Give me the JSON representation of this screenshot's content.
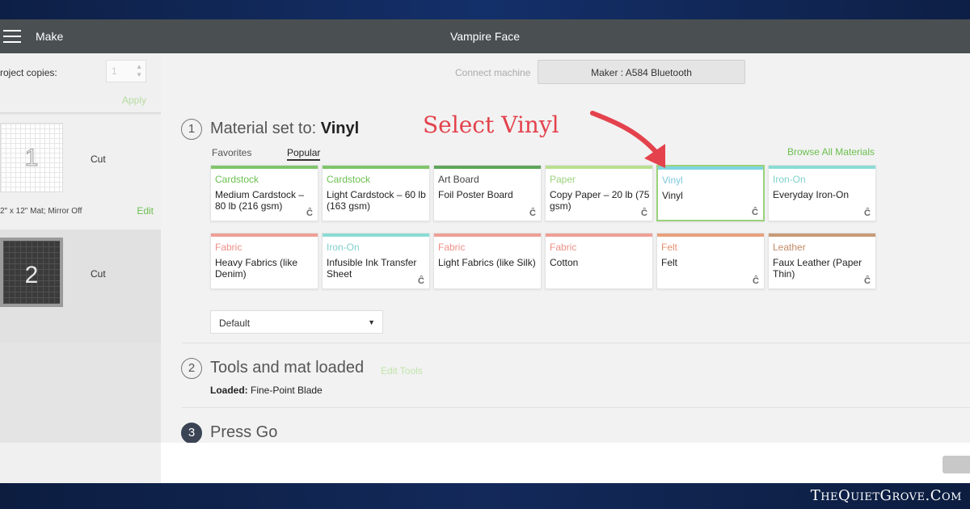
{
  "app": {
    "menu_label": "Make",
    "project_title": "Vampire Face"
  },
  "sidebar": {
    "copies_label": "roject copies:",
    "copies_value": "1",
    "apply_label": "Apply",
    "mats": [
      {
        "number": "1",
        "action": "Cut",
        "info": "2\" x 12\" Mat; Mirror Off",
        "edit_label": "Edit",
        "theme": "light"
      },
      {
        "number": "2",
        "action": "Cut",
        "theme": "dark"
      }
    ]
  },
  "connect": {
    "label": "Connect machine",
    "machine": "Maker : A584 Bluetooth"
  },
  "step1": {
    "number": "1",
    "title_prefix": "Material set to:",
    "title_value": "Vinyl",
    "tabs": [
      "Favorites",
      "Popular"
    ],
    "active_tab": "Popular",
    "browse_label": "Browse All Materials",
    "materials": [
      {
        "category": "Cardstock",
        "name": "Medium Cardstock – 80 lb (216 gsm)",
        "color": "#7fc56b",
        "cat_color": "#6bbf4e",
        "icon": true
      },
      {
        "category": "Cardstock",
        "name": "Light Cardstock – 60 lb (163 gsm)",
        "color": "#7fc56b",
        "cat_color": "#6bbf4e",
        "icon": false
      },
      {
        "category": "Art Board",
        "name": "Foil Poster Board",
        "color": "#5ea65a",
        "cat_color": "#444444",
        "icon": true
      },
      {
        "category": "Paper",
        "name": "Copy Paper – 20 lb (75 gsm)",
        "color": "#b9e08f",
        "cat_color": "#9bd27d",
        "icon": true
      },
      {
        "category": "Vinyl",
        "name": "Vinyl",
        "color": "#7fd6e0",
        "cat_color": "#7fc8e0",
        "icon": true,
        "selected": true
      },
      {
        "category": "Iron-On",
        "name": "Everyday Iron-On",
        "color": "#8adcd4",
        "cat_color": "#7fd0cc",
        "icon": true
      },
      {
        "category": "Fabric",
        "name": "Heavy Fabrics (like Denim)",
        "color": "#ef9e96",
        "cat_color": "#ef8f86",
        "icon": false
      },
      {
        "category": "Iron-On",
        "name": "Infusible Ink Transfer Sheet",
        "color": "#8adcd4",
        "cat_color": "#7fd0cc",
        "icon": true
      },
      {
        "category": "Fabric",
        "name": "Light Fabrics (like Silk)",
        "color": "#ef9e96",
        "cat_color": "#ef8f86",
        "icon": false
      },
      {
        "category": "Fabric",
        "name": "Cotton",
        "color": "#ef9e96",
        "cat_color": "#ef8f86",
        "icon": false
      },
      {
        "category": "Felt",
        "name": "Felt",
        "color": "#e9a07e",
        "cat_color": "#e59070",
        "icon": true
      },
      {
        "category": "Leather",
        "name": "Faux Leather (Paper Thin)",
        "color": "#c79a77",
        "cat_color": "#c28a66",
        "icon": true
      }
    ],
    "pressure": "Default"
  },
  "step2": {
    "number": "2",
    "title": "Tools and mat loaded",
    "edit_label": "Edit Tools",
    "loaded_label": "Loaded:",
    "loaded_value": "Fine-Point Blade"
  },
  "step3": {
    "number": "3",
    "title": "Press Go"
  },
  "annotation": {
    "text": "Select Vinyl",
    "color": "#e4424d"
  },
  "watermark": "TheQuietGrove.Com"
}
